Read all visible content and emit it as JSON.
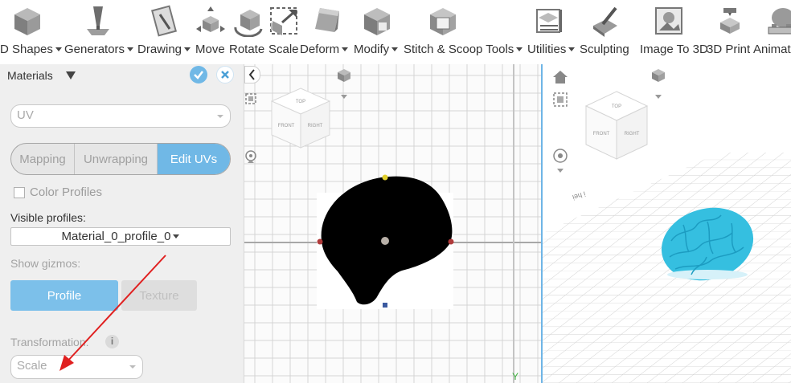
{
  "toolbar": {
    "items": [
      {
        "label": "D Shapes",
        "icon": "cube-icon",
        "dropdown": true
      },
      {
        "label": "Generators",
        "icon": "generator-pin-icon",
        "dropdown": true
      },
      {
        "label": "Drawing",
        "icon": "drawing-icon",
        "dropdown": true
      },
      {
        "label": "Move",
        "icon": "move-icon",
        "dropdown": false
      },
      {
        "label": "Rotate",
        "icon": "rotate-icon",
        "dropdown": false
      },
      {
        "label": "Scale",
        "icon": "scale-icon",
        "dropdown": false
      },
      {
        "label": "Deform",
        "icon": "deform-icon",
        "dropdown": true
      },
      {
        "label": "Modify",
        "icon": "modify-icon",
        "dropdown": true
      },
      {
        "label": "Stitch & Scoop Tools",
        "icon": "stitch-scoop-icon",
        "dropdown": true
      },
      {
        "label": "Utilities",
        "icon": "utilities-icon",
        "dropdown": true
      },
      {
        "label": "Sculpting",
        "icon": "sculpting-icon",
        "dropdown": false
      },
      {
        "label": "Image To 3D",
        "icon": "image-to-3d-icon",
        "dropdown": false
      },
      {
        "label": "3D Print",
        "icon": "3d-print-icon",
        "dropdown": false
      },
      {
        "label": "Animat",
        "icon": "animation-icon",
        "dropdown": false
      }
    ]
  },
  "panel": {
    "title": "Materials",
    "uv_select": "UV",
    "tabs": [
      "Mapping",
      "Unwrapping",
      "Edit UVs"
    ],
    "active_tab": "Edit UVs",
    "color_profiles_label": "Color Profiles",
    "visible_profiles_label": "Visible profiles:",
    "visible_profile_value": "Material_0_profile_0",
    "show_gizmos_label": "Show gizmos:",
    "profile_button": "Profile",
    "texture_button": "Texture",
    "transformation_label": "Transformation:",
    "transformation_value": "Scale"
  },
  "viewport_left": {
    "cube_faces": [
      "TOP",
      "FRONT",
      "RIGHT"
    ],
    "axis_label": "Y"
  },
  "viewport_right": {
    "cube_faces": [
      "TOP",
      "FRONT",
      "RIGHT"
    ],
    "ground_text": "ᴉǝɥ ᴉ"
  },
  "colors": {
    "accent": "#70b8e6",
    "shape_fill": "#000000",
    "brain": "#35bfe0",
    "annotation_arrow": "#e02020"
  }
}
